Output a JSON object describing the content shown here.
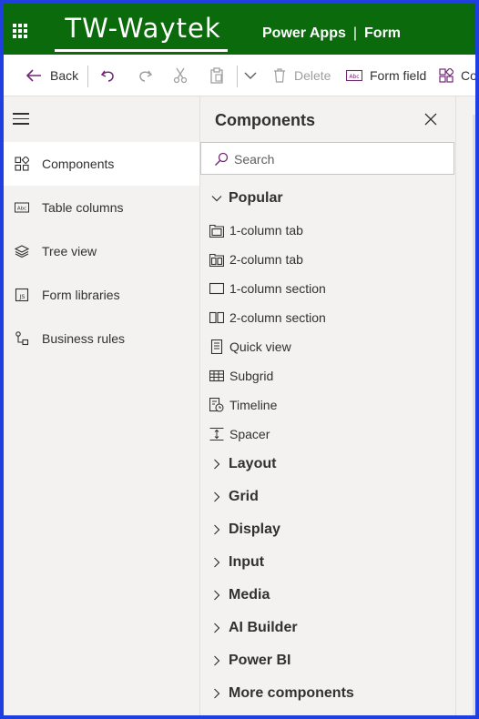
{
  "header": {
    "logo_text": "TW-Waytek",
    "app_name": "Power Apps",
    "separator": "|",
    "page_name": "Form"
  },
  "toolbar": {
    "back_label": "Back",
    "delete_label": "Delete",
    "form_field_label": "Form field",
    "components_label": "Co"
  },
  "leftnav": {
    "items": [
      {
        "label": "Components",
        "icon": "components-icon",
        "active": true
      },
      {
        "label": "Table columns",
        "icon": "table-columns-icon",
        "active": false
      },
      {
        "label": "Tree view",
        "icon": "tree-view-icon",
        "active": false
      },
      {
        "label": "Form libraries",
        "icon": "js-library-icon",
        "active": false
      },
      {
        "label": "Business rules",
        "icon": "business-rules-icon",
        "active": false
      }
    ]
  },
  "panel": {
    "title": "Components",
    "search_placeholder": "Search",
    "popular_header": "Popular",
    "popular_items": [
      {
        "label": "1-column tab",
        "icon": "one-column-tab-icon"
      },
      {
        "label": "2-column tab",
        "icon": "two-column-tab-icon"
      },
      {
        "label": "1-column section",
        "icon": "one-column-section-icon"
      },
      {
        "label": "2-column section",
        "icon": "two-column-section-icon"
      },
      {
        "label": "Quick view",
        "icon": "quick-view-icon"
      },
      {
        "label": "Subgrid",
        "icon": "subgrid-icon"
      },
      {
        "label": "Timeline",
        "icon": "timeline-icon"
      },
      {
        "label": "Spacer",
        "icon": "spacer-icon"
      }
    ],
    "collapsed_sections": [
      "Layout",
      "Grid",
      "Display",
      "Input",
      "Media",
      "AI Builder",
      "Power BI",
      "More components"
    ]
  },
  "colors": {
    "header_bg": "#0b6a0b",
    "border_blue": "#1f3fe0",
    "accent_purple": "#742774",
    "panel_bg": "#f3f2f1"
  }
}
